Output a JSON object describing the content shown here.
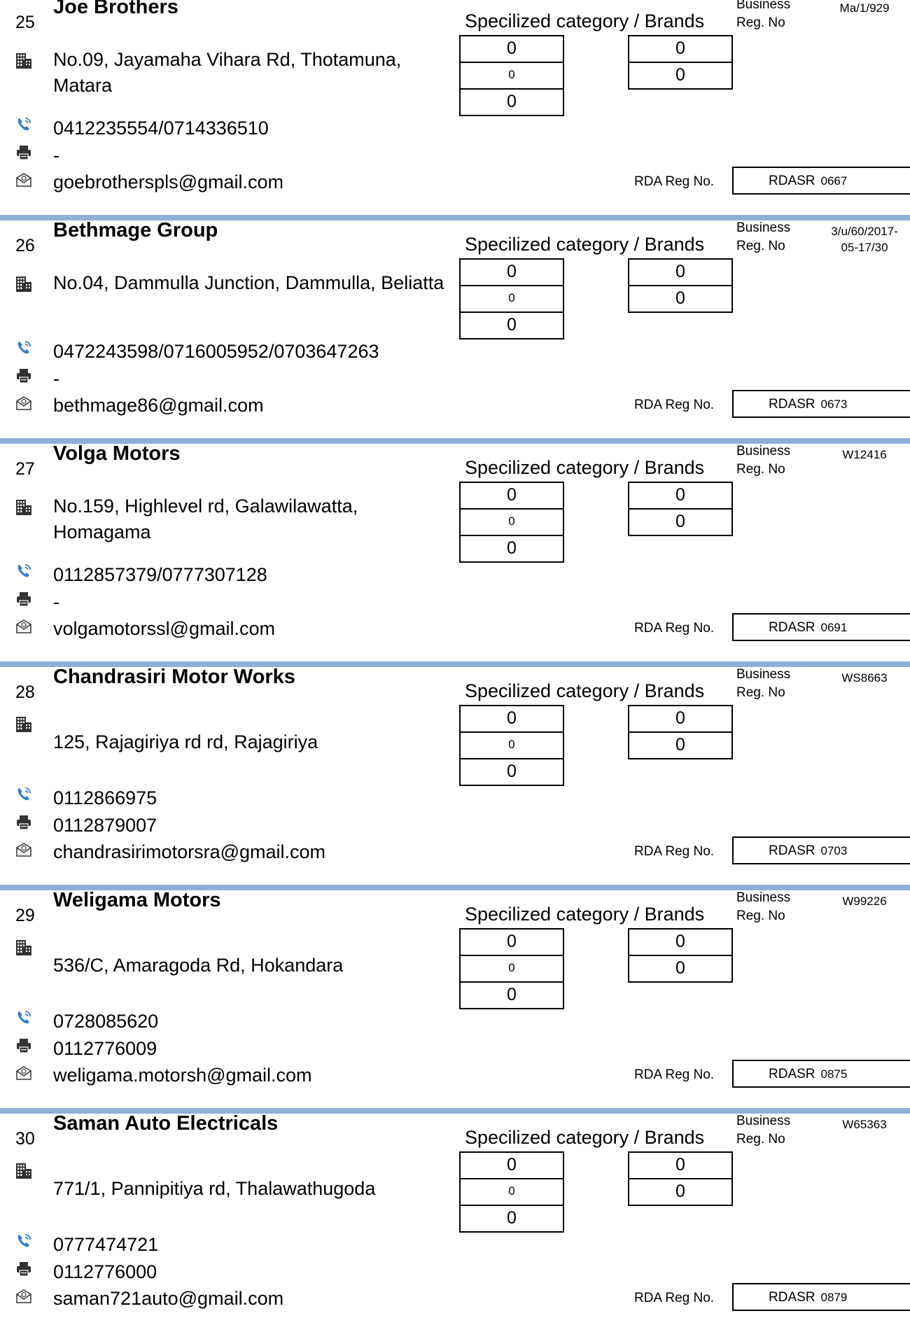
{
  "labels": {
    "spec_title": "Specilized category / Brands",
    "business_reg_line1": "Business",
    "business_reg_line2": "Reg. No",
    "rda_reg_label": "RDA Reg No.",
    "rda_prefix": "RDASR"
  },
  "icons": {
    "address": "building-icon",
    "phone": "phone-icon",
    "fax": "printer-icon",
    "email": "email-icon"
  },
  "colors": {
    "separator": "#8fb0d6"
  },
  "entries": [
    {
      "number": "25",
      "name": "Joe Brothers",
      "address": "No.09, Jayamaha Vihara Rd, Thotamuna, Matara",
      "phone": "0412235554/0714336510",
      "fax": "-",
      "email": "goebrotherspls@gmail.com",
      "business_reg_no": "Ma/1/929",
      "rda_code": "0667",
      "brand_boxes": [
        "0",
        "0",
        "0",
        "0",
        "0"
      ]
    },
    {
      "number": "26",
      "name": "Bethmage Group",
      "address": "No.04, Dammulla Junction, Dammulla, Beliatta",
      "phone": "0472243598/0716005952/0703647263",
      "fax": "-",
      "email": "bethmage86@gmail.com",
      "business_reg_no": "3/u/60/2017-05-17/30",
      "rda_code": "0673",
      "brand_boxes": [
        "0",
        "0",
        "0",
        "0",
        "0"
      ]
    },
    {
      "number": "27",
      "name": "Volga Motors",
      "address": "No.159, Highlevel rd, Galawilawatta, Homagama",
      "phone": "0112857379/0777307128",
      "fax": "-",
      "email": "volgamotorssl@gmail.com",
      "business_reg_no": "W12416",
      "rda_code": "0691",
      "brand_boxes": [
        "0",
        "0",
        "0",
        "0",
        "0"
      ]
    },
    {
      "number": "28",
      "name": "Chandrasiri Motor Works",
      "address": "125, Rajagiriya rd rd, Rajagiriya",
      "phone": "0112866975",
      "fax": "0112879007",
      "email": "chandrasirimotorsra@gmail.com",
      "business_reg_no": "WS8663",
      "rda_code": "0703",
      "brand_boxes": [
        "0",
        "0",
        "0",
        "0",
        "0"
      ]
    },
    {
      "number": "29",
      "name": "Weligama Motors",
      "address": "536/C, Amaragoda Rd, Hokandara",
      "phone": "0728085620",
      "fax": "0112776009",
      "email": "weligama.motorsh@gmail.com",
      "business_reg_no": "W99226",
      "rda_code": "0875",
      "brand_boxes": [
        "0",
        "0",
        "0",
        "0",
        "0"
      ]
    },
    {
      "number": "30",
      "name": "Saman Auto Electricals",
      "address": "771/1, Pannipitiya rd, Thalawathugoda",
      "phone": "0777474721",
      "fax": "0112776000",
      "email": "saman721auto@gmail.com",
      "business_reg_no": "W65363",
      "rda_code": "0879",
      "brand_boxes": [
        "0",
        "0",
        "0",
        "0",
        "0"
      ]
    }
  ]
}
